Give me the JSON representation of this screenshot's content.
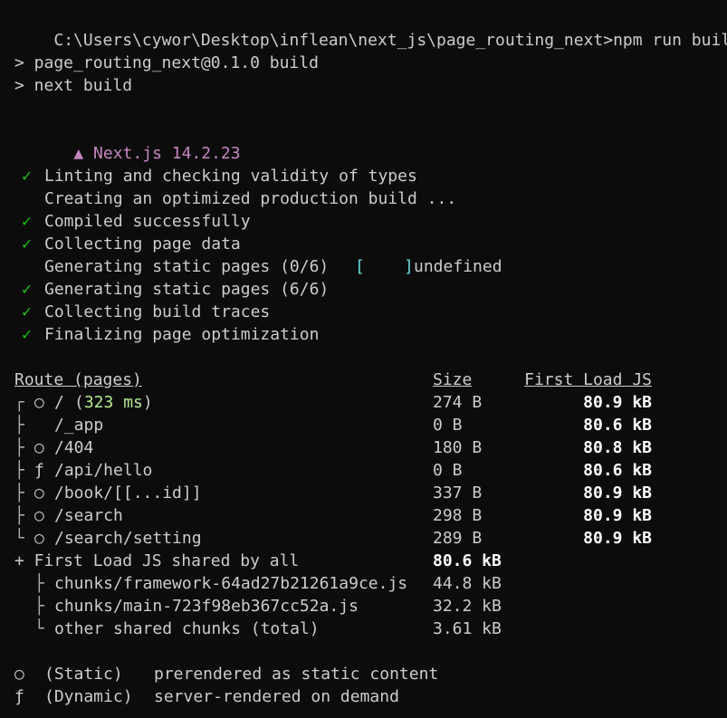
{
  "prompt_line": {
    "path": "C:\\Users\\cywor\\Desktop\\inflean\\next_js\\page_routing_next>",
    "command": "npm run build"
  },
  "npm_script": {
    "line1": "> page_routing_next@0.1.0 build",
    "line2": "> next build"
  },
  "banner": {
    "icon": "▲",
    "label": "Next.js 14.2.23"
  },
  "steps": [
    {
      "check": "✓",
      "text": "Linting and checking validity of types"
    },
    {
      "check": "",
      "text": "Creating an optimized production build ..."
    },
    {
      "check": "✓",
      "text": "Compiled successfully"
    },
    {
      "check": "✓",
      "text": "Collecting page data"
    },
    {
      "check": "",
      "text": "Generating static pages (0/6)",
      "bracket_open": "[",
      "bracket_close": "]",
      "suffix": "undefined"
    },
    {
      "check": "✓",
      "text": "Generating static pages (6/6)"
    },
    {
      "check": "✓",
      "text": "Collecting build traces"
    },
    {
      "check": "✓",
      "text": "Finalizing page optimization"
    }
  ],
  "routes_table": {
    "headers": {
      "route": "Route (pages)",
      "size": "Size",
      "first_load": "First Load JS"
    },
    "rows": [
      {
        "tree": "┌",
        "symbol": "○",
        "route": "/",
        "timing": "(323 ms)",
        "size": "274 B",
        "first_load": "80.9 kB"
      },
      {
        "tree": "├",
        "symbol": "",
        "route": "/_app",
        "timing": "",
        "size": "0 B",
        "first_load": "80.6 kB"
      },
      {
        "tree": "├",
        "symbol": "○",
        "route": "/404",
        "timing": "",
        "size": "180 B",
        "first_load": "80.8 kB"
      },
      {
        "tree": "├",
        "symbol": "ƒ",
        "route": "/api/hello",
        "timing": "",
        "size": "0 B",
        "first_load": "80.6 kB"
      },
      {
        "tree": "├",
        "symbol": "○",
        "route": "/book/[[...id]]",
        "timing": "",
        "size": "337 B",
        "first_load": "80.9 kB"
      },
      {
        "tree": "├",
        "symbol": "○",
        "route": "/search",
        "timing": "",
        "size": "298 B",
        "first_load": "80.9 kB"
      },
      {
        "tree": "└",
        "symbol": "○",
        "route": "/search/setting",
        "timing": "",
        "size": "289 B",
        "first_load": "80.9 kB"
      }
    ],
    "shared": {
      "label": "+ First Load JS shared by all",
      "total": "80.6 kB",
      "chunks": [
        {
          "tree": "├",
          "name": "chunks/framework-64ad27b21261a9ce.js",
          "size": "44.8 kB"
        },
        {
          "tree": "├",
          "name": "chunks/main-723f98eb367cc52a.js",
          "size": "32.2 kB"
        },
        {
          "tree": "└",
          "name": "other shared chunks (total)",
          "size": "3.61 kB"
        }
      ]
    }
  },
  "legend": [
    {
      "symbol": "○",
      "type": "(Static)",
      "description": "prerendered as static content"
    },
    {
      "symbol": "ƒ",
      "type": "(Dynamic)",
      "description": "server-rendered on demand"
    }
  ],
  "colors": {
    "background": "#0c0c0c",
    "foreground": "#cccccc",
    "check": "#16c60c",
    "nextjs_banner": "#c586c0",
    "bracket": "#61d6d6",
    "timing": "#b5e890",
    "bold": "#ffffff"
  }
}
